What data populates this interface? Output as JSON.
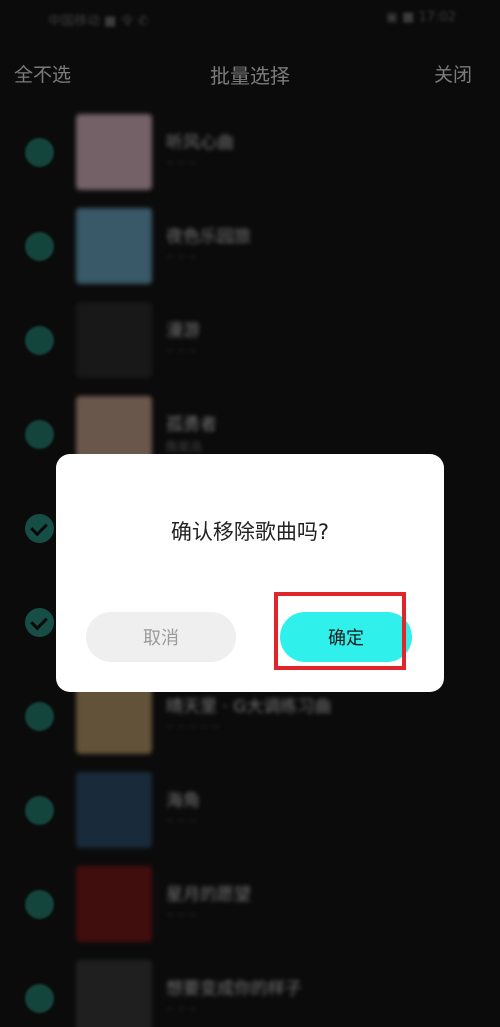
{
  "header": {
    "left_action": "全不选",
    "title": "批量选择",
    "right_action": "关闭"
  },
  "status_bar": {
    "left": "中国移动 ■ 令 ✆",
    "right": "▣ ■ 17:02"
  },
  "songs": [
    {
      "title": "听风心曲",
      "sub": "·· ·· ··",
      "cover_color": "#d9b8c2",
      "checked": false
    },
    {
      "title": "夜色乐园旅",
      "sub": "·· ·· ··",
      "cover_color": "#6aa6c4",
      "checked": false
    },
    {
      "title": "漫游",
      "sub": "·· ·· ··",
      "cover_color": "#2a2a2a",
      "checked": false
    },
    {
      "title": "孤勇者",
      "sub": "陈奕迅",
      "cover_color": "#c9a48f",
      "checked": false
    },
    {
      "title": "",
      "sub": "",
      "cover_color": "#4a4a4a",
      "checked": true
    },
    {
      "title": "",
      "sub": "",
      "cover_color": "#4a4a4a",
      "checked": true
    },
    {
      "title": "晴天里 · G大调练习曲",
      "sub": "·· ·· ·· ·· ··",
      "cover_color": "#b99a6a",
      "checked": false
    },
    {
      "title": "海角",
      "sub": "·· ·· ··",
      "cover_color": "#2d4f6e",
      "checked": false
    },
    {
      "title": "星月的愿望",
      "sub": "·· ·· ··",
      "cover_color": "#7a1818",
      "checked": false
    },
    {
      "title": "想要变成你的样子",
      "sub": "·· ·· ··",
      "cover_color": "#3a3a3a",
      "checked": false
    }
  ],
  "dialog": {
    "message": "确认移除歌曲吗?",
    "cancel_label": "取消",
    "confirm_label": "确定"
  },
  "colors": {
    "accent": "#2ff0ea",
    "highlight": "#e0262b",
    "check": "#23786a"
  }
}
